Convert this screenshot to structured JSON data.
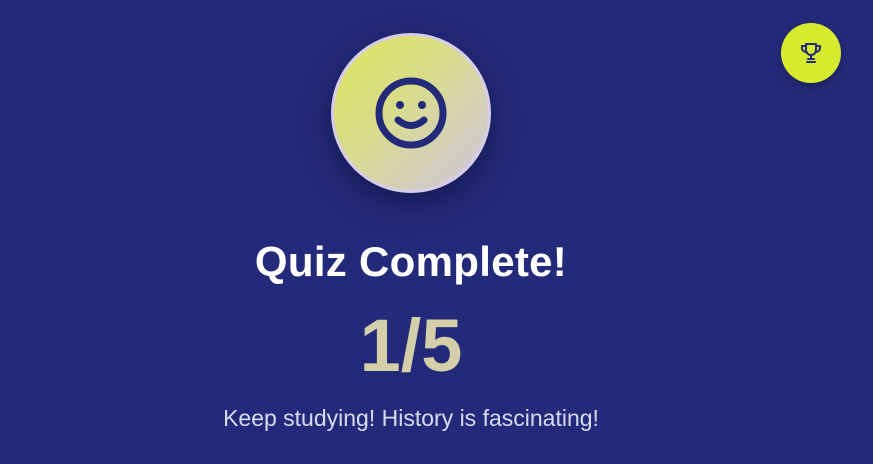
{
  "result": {
    "icon": "smiley-face-icon",
    "title": "Quiz Complete!",
    "score": "1/5",
    "message": "Keep studying! History is fascinating!"
  },
  "corner_button": {
    "icon": "trophy-icon"
  },
  "colors": {
    "background": "#242a7a",
    "accent": "#d6ea2e",
    "score": "#d4cfa9",
    "icon_stroke": "#242a7a"
  }
}
